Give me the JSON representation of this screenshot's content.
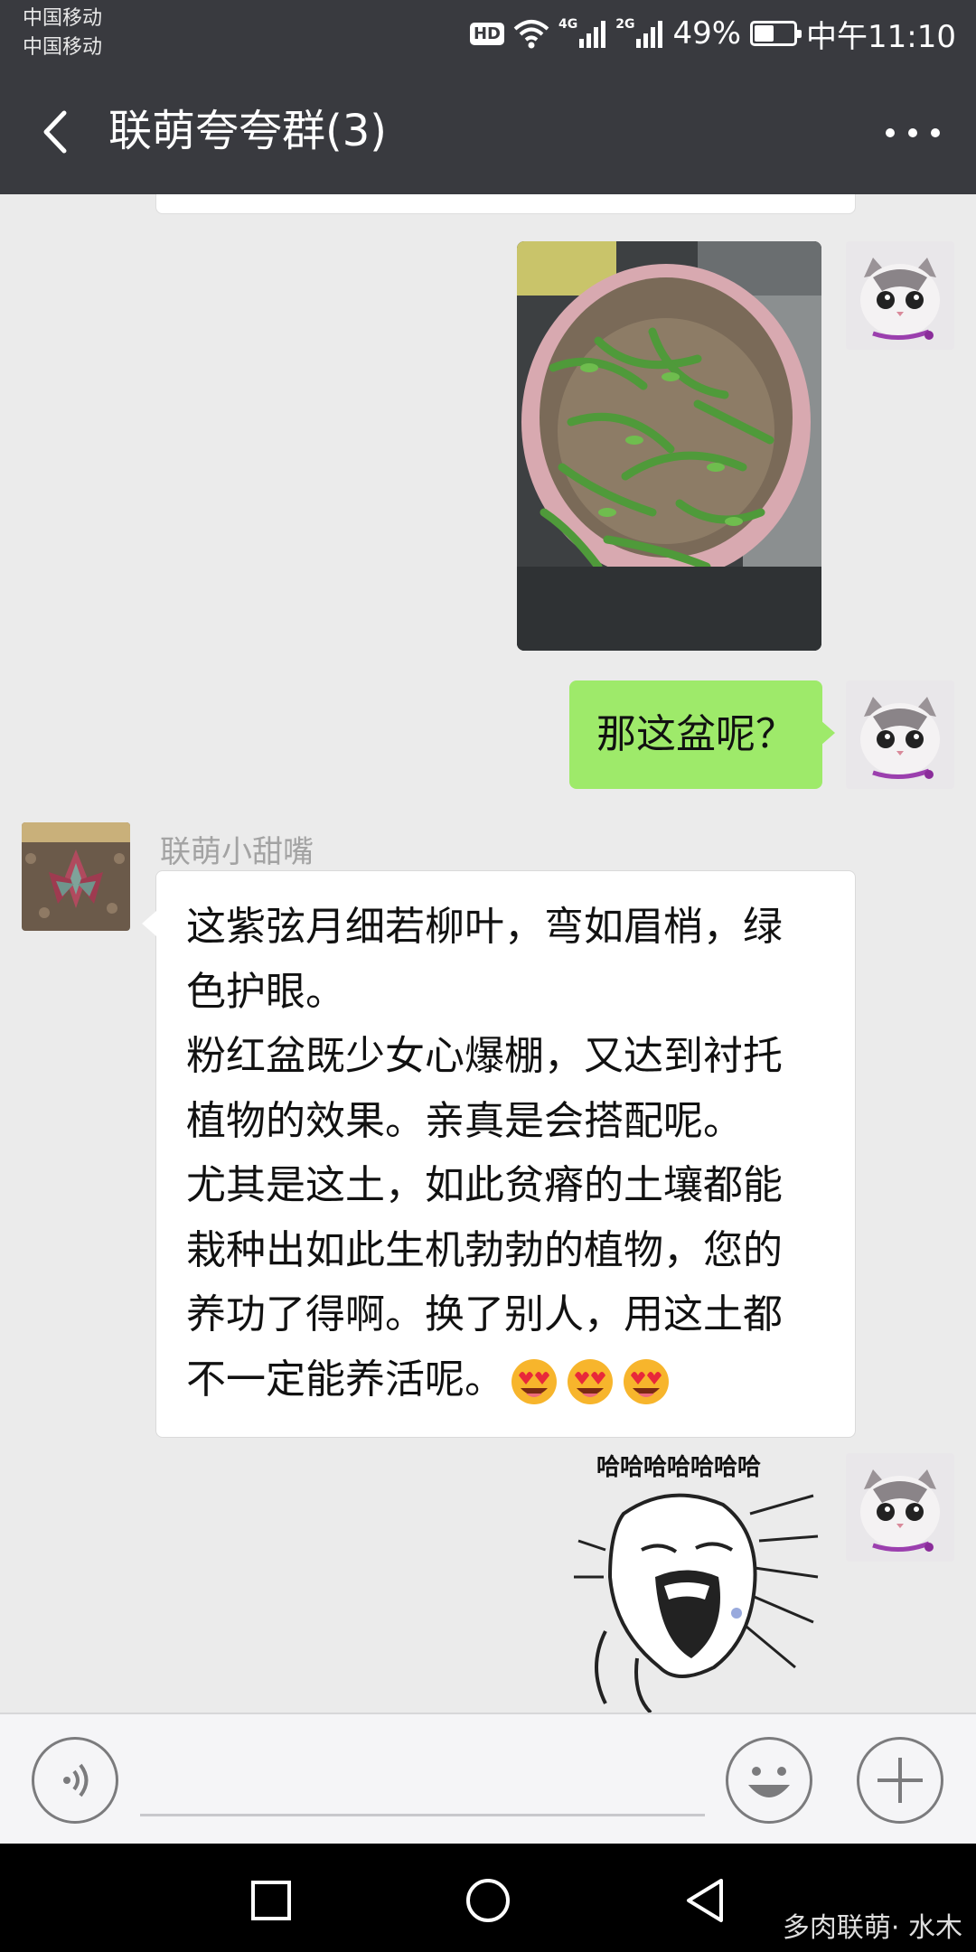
{
  "status_bar": {
    "carrier_1": "中国移动",
    "carrier_2": "中国移动",
    "hd": "HD",
    "network_1": "4G",
    "network_2": "2G",
    "battery_percent": "49%",
    "battery_level": 0.49,
    "time": "中午11:10"
  },
  "header": {
    "title": "联萌夸夸群(3)"
  },
  "messages": {
    "green_text": "那这盆呢？",
    "sender_name": "联萌小甜嘴",
    "reply_lines": [
      "这紫弦月细若柳叶，弯如眉梢，绿",
      "色护眼。",
      "粉红盆既少女心爆棚，又达到衬托",
      "植物的效果。亲真是会搭配呢。",
      "尤其是这土，如此贫瘠的土壤都能",
      "栽种出如此生机勃勃的植物，您的",
      "养功了得啊。换了别人，用这土都",
      "不一定能养活呢。"
    ],
    "sticker_text": "哈哈哈哈哈哈哈"
  },
  "watermark": "多肉联萌· 水木",
  "colors": {
    "header_bg": "#393a3f",
    "chat_bg": "#ebebeb",
    "green_bubble": "#9eea6a"
  }
}
